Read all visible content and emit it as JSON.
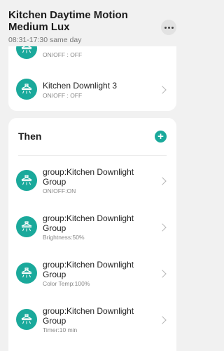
{
  "header": {
    "title": "Kitchen Daytime Motion Medium Lux",
    "schedule": "08:31-17:30 same day"
  },
  "conditions": [
    {
      "label": "ON/OFF : OFF",
      "icon": "downlight-icon"
    },
    {
      "name": "Kitchen Downlight 3",
      "label": "ON/OFF : OFF",
      "icon": "downlight-icon"
    }
  ],
  "then": {
    "title": "Then",
    "actions": [
      {
        "name": "group:Kitchen Downlight Group",
        "status": "ON/OFF:ON"
      },
      {
        "name": "group:Kitchen Downlight Group",
        "status": "Brightness:50%"
      },
      {
        "name": "group:Kitchen Downlight Group",
        "status": "Color Temp:100%"
      },
      {
        "name": "group:Kitchen Downlight Group",
        "status": "Timer:10 min"
      }
    ]
  },
  "colors": {
    "accent": "#1aa99b",
    "background": "#f1f1f1"
  }
}
